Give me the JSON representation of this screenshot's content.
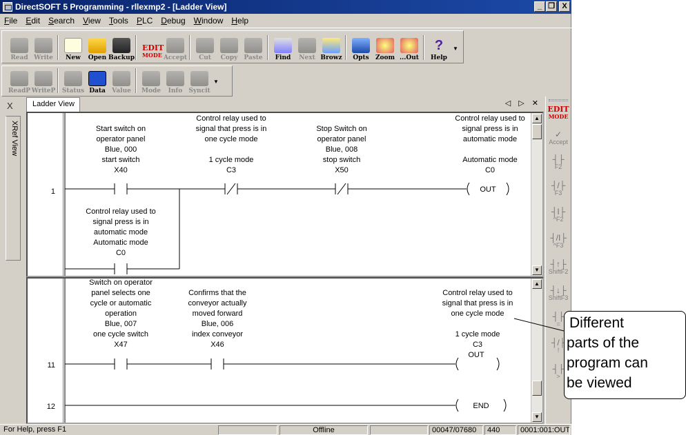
{
  "window": {
    "title": "DirectSOFT 5 Programming - rllexmp2 - [Ladder View]",
    "controls": {
      "minimize": "_",
      "restore": "&#8718;",
      "close": "X"
    }
  },
  "menu": [
    "File",
    "Edit",
    "Search",
    "View",
    "Tools",
    "PLC",
    "Debug",
    "Window",
    "Help"
  ],
  "toolbar1": [
    {
      "label": "Read",
      "icon": "read-icon",
      "enabled": false
    },
    {
      "label": "Write",
      "icon": "write-icon",
      "enabled": false
    },
    {
      "label": "New",
      "icon": "new-file-icon",
      "enabled": true
    },
    {
      "label": "Open",
      "icon": "open-folder-icon",
      "enabled": true
    },
    {
      "label": "Backup",
      "icon": "backup-icon",
      "enabled": true
    },
    {
      "label": "EDIT MODE",
      "icon": "edit-mode-icon",
      "enabled": true
    },
    {
      "label": "Accept",
      "icon": "accept-icon",
      "enabled": false
    },
    {
      "label": "Cut",
      "icon": "cut-icon",
      "enabled": false
    },
    {
      "label": "Copy",
      "icon": "copy-icon",
      "enabled": false
    },
    {
      "label": "Paste",
      "icon": "paste-icon",
      "enabled": false
    },
    {
      "label": "Find",
      "icon": "find-icon",
      "enabled": true
    },
    {
      "label": "Next",
      "icon": "find-next-icon",
      "enabled": false
    },
    {
      "label": "Browz",
      "icon": "browse-icon",
      "enabled": true
    },
    {
      "label": "Opts",
      "icon": "options-icon",
      "enabled": true
    },
    {
      "label": "Zoom",
      "icon": "zoom-icon",
      "enabled": true
    },
    {
      "label": "...Out",
      "icon": "zoom-out-icon",
      "enabled": true
    },
    {
      "label": "Help",
      "icon": "help-icon",
      "enabled": true
    }
  ],
  "toolbar2": [
    {
      "label": "ReadP",
      "icon": "read-plc-icon",
      "enabled": false
    },
    {
      "label": "WriteP",
      "icon": "write-plc-icon",
      "enabled": false
    },
    {
      "label": "Status",
      "icon": "status-icon",
      "enabled": false
    },
    {
      "label": "Data",
      "icon": "data-icon",
      "enabled": true
    },
    {
      "label": "Value",
      "icon": "value-icon",
      "enabled": false
    },
    {
      "label": "Mode",
      "icon": "mode-icon",
      "enabled": false
    },
    {
      "label": "Info",
      "icon": "info-icon",
      "enabled": false
    },
    {
      "label": "Syncit",
      "icon": "sync-icon",
      "enabled": false
    }
  ],
  "xref_tab": {
    "label": "XRef View",
    "close": "X"
  },
  "ladder": {
    "tab_label": "Ladder View",
    "nav": "◁ ▷ ✕",
    "pane1": {
      "rung1": {
        "number": "1",
        "contact1": {
          "desc": [
            "Start switch on",
            "operator panel",
            "Blue, 000"
          ],
          "nick": "start switch",
          "addr": "X40"
        },
        "contact2": {
          "desc": [
            "Control relay used to",
            "signal that press is in",
            "one cycle mode"
          ],
          "nick": "1 cycle mode",
          "addr": "C3"
        },
        "contact3": {
          "desc": [
            "Stop Switch on",
            "operator panel",
            "Blue, 008"
          ],
          "nick": "stop switch",
          "addr": "X50"
        },
        "coil": {
          "desc": [
            "Control relay used to",
            "signal press is in",
            "automatic mode"
          ],
          "nick": "Automatic mode",
          "addr": "C0",
          "type": "OUT"
        },
        "branch_contact": {
          "desc": [
            "Control relay used to",
            "signal press is in",
            "automatic mode"
          ],
          "nick": "Automatic mode",
          "addr": "C0"
        }
      }
    },
    "pane2": {
      "rung11": {
        "number": "11",
        "contact1": {
          "desc": [
            "Switch on operator",
            "panel selects one",
            "cycle or automatic",
            "operation",
            "Blue, 007"
          ],
          "nick": "one cycle switch",
          "addr": "X47"
        },
        "contact2": {
          "desc": [
            "Confirms that the",
            "conveyor actually",
            "moved forward",
            "Blue, 006"
          ],
          "nick": "index conveyor",
          "addr": "X46"
        },
        "coil": {
          "desc": [
            "Control relay used to",
            "signal that press is in",
            "one cycle mode"
          ],
          "nick": "1 cycle mode",
          "addr": "C3",
          "type": "OUT"
        }
      },
      "rung12": {
        "number": "12",
        "coil": "END"
      }
    }
  },
  "palette": [
    {
      "label": "EDIT MODE",
      "icon": "edit-mode-icon"
    },
    {
      "label": "Accept",
      "icon": "accept-icon"
    },
    {
      "label": "F2",
      "icon": "contact-no-icon",
      "sym": "┤├"
    },
    {
      "label": "F3",
      "icon": "contact-nc-icon",
      "sym": "┤/├"
    },
    {
      "label": "^F2",
      "icon": "immediate-contact-icon",
      "sym": "┤I├"
    },
    {
      "label": "^F3",
      "icon": "immediate-nc-contact-icon",
      "sym": "┤/I├"
    },
    {
      "label": "ShiftF2",
      "icon": "rising-edge-icon",
      "sym": "┤↑├"
    },
    {
      "label": "ShiftF3",
      "icon": "falling-edge-icon",
      "sym": "┤↓├"
    },
    {
      "label": "=",
      "icon": "compare-equal-icon",
      "sym": "┤├"
    },
    {
      "label": "!",
      "icon": "compare-not-equal-icon",
      "sym": "┤/├"
    },
    {
      "label": ">",
      "icon": "compare-greater-icon",
      "sym": "┤├"
    }
  ],
  "statusbar": {
    "help": "For Help, press F1",
    "mode": "Offline",
    "addr": "00047/07680",
    "size": "440",
    "pos": "0001:001:OUT"
  },
  "callout": {
    "text": [
      "Different",
      "parts of the",
      "program can",
      "be viewed"
    ]
  }
}
